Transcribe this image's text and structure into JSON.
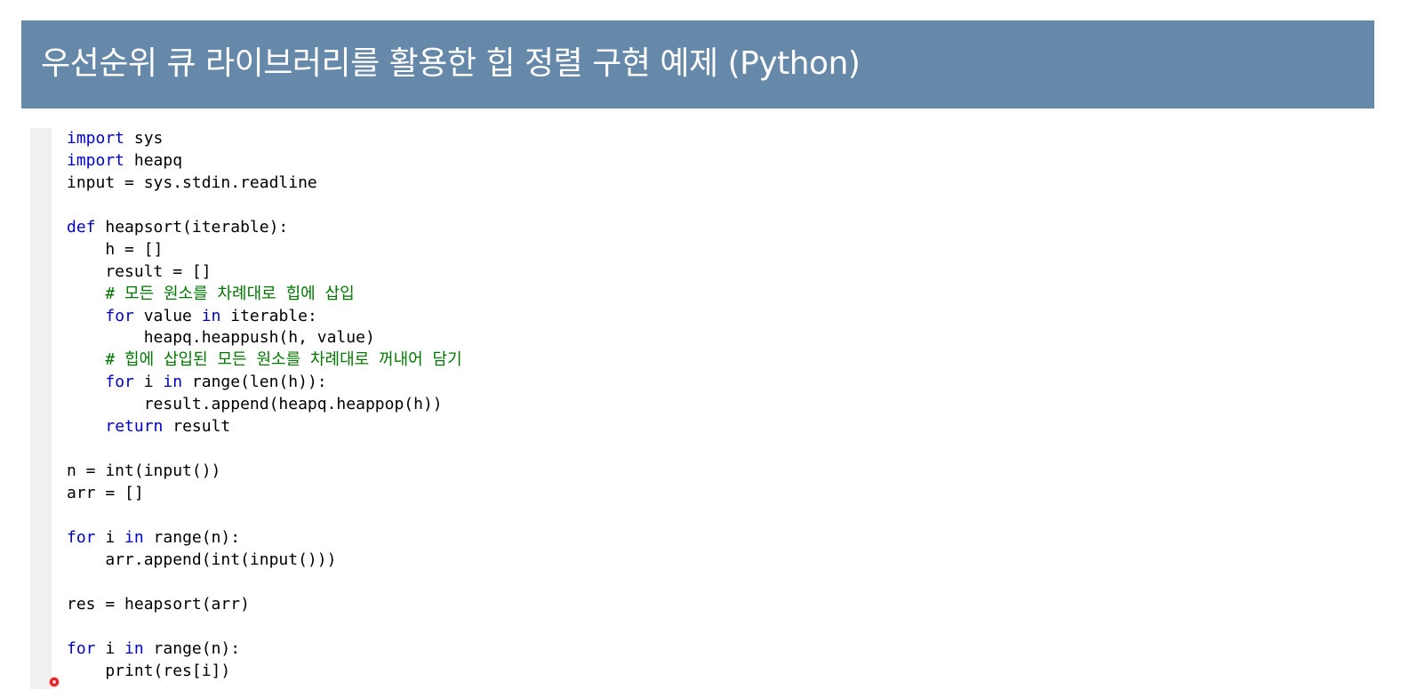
{
  "title": "우선순위 큐 라이브러리를 활용한 힙 정렬 구현 예제 (Python)",
  "code_lines": [
    [
      {
        "t": "import",
        "k": "kw"
      },
      {
        "t": " sys",
        "k": "tx"
      }
    ],
    [
      {
        "t": "import",
        "k": "kw"
      },
      {
        "t": " heapq",
        "k": "tx"
      }
    ],
    [
      {
        "t": "input = sys.stdin.readline",
        "k": "tx"
      }
    ],
    [],
    [
      {
        "t": "def",
        "k": "kw"
      },
      {
        "t": " heapsort(iterable):",
        "k": "tx"
      }
    ],
    [
      {
        "t": "    h = []",
        "k": "tx"
      }
    ],
    [
      {
        "t": "    result = []",
        "k": "tx"
      }
    ],
    [
      {
        "t": "    # 모든 원소를 차례대로 힙에 삽입",
        "k": "cm"
      }
    ],
    [
      {
        "t": "    ",
        "k": "tx"
      },
      {
        "t": "for",
        "k": "kw"
      },
      {
        "t": " value ",
        "k": "tx"
      },
      {
        "t": "in",
        "k": "kw"
      },
      {
        "t": " iterable:",
        "k": "tx"
      }
    ],
    [
      {
        "t": "        heapq.heappush(h, value)",
        "k": "tx"
      }
    ],
    [
      {
        "t": "    # 힙에 삽입된 모든 원소를 차례대로 꺼내어 담기",
        "k": "cm"
      }
    ],
    [
      {
        "t": "    ",
        "k": "tx"
      },
      {
        "t": "for",
        "k": "kw"
      },
      {
        "t": " i ",
        "k": "tx"
      },
      {
        "t": "in",
        "k": "kw"
      },
      {
        "t": " range(len(h)):",
        "k": "tx"
      }
    ],
    [
      {
        "t": "        result.append(heapq.heappop(h))",
        "k": "tx"
      }
    ],
    [
      {
        "t": "    ",
        "k": "tx"
      },
      {
        "t": "return",
        "k": "kw"
      },
      {
        "t": " result",
        "k": "tx"
      }
    ],
    [],
    [
      {
        "t": "n = int(input())",
        "k": "tx"
      }
    ],
    [
      {
        "t": "arr = []",
        "k": "tx"
      }
    ],
    [],
    [
      {
        "t": "for",
        "k": "kw"
      },
      {
        "t": " i ",
        "k": "tx"
      },
      {
        "t": "in",
        "k": "kw"
      },
      {
        "t": " range(n):",
        "k": "tx"
      }
    ],
    [
      {
        "t": "    arr.append(int(input()))",
        "k": "tx"
      }
    ],
    [],
    [
      {
        "t": "res = heapsort(arr)",
        "k": "tx"
      }
    ],
    [],
    [
      {
        "t": "for",
        "k": "kw"
      },
      {
        "t": " i ",
        "k": "tx"
      },
      {
        "t": "in",
        "k": "kw"
      },
      {
        "t": " range(n):",
        "k": "tx"
      }
    ],
    [
      {
        "t": "    print(res[i])",
        "k": "tx"
      }
    ]
  ],
  "colors": {
    "title_bar": "#6688a9",
    "keyword": "#0000cc",
    "comment": "#007700",
    "code_gutter": "#f0f0f0",
    "pointer": "#e02020"
  }
}
